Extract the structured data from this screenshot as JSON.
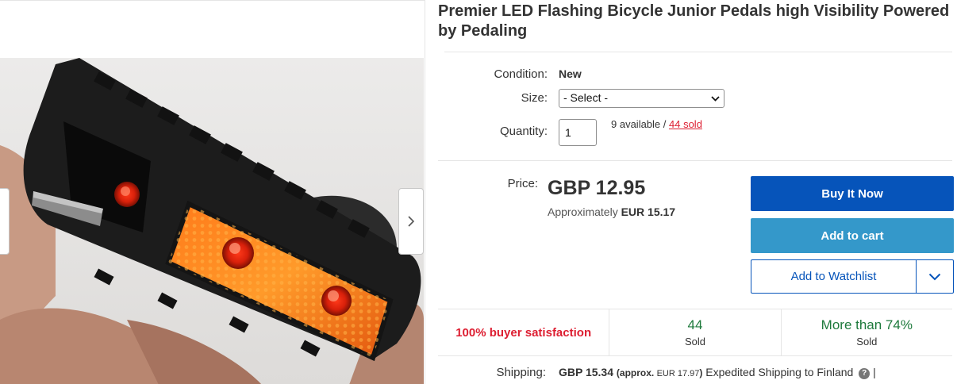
{
  "product": {
    "title": "Premier LED Flashing Bicycle Junior Pedals high Visibility Powered by Pedaling"
  },
  "gallery": {
    "prev_icon": "chevron-left-icon",
    "next_icon": "chevron-right-icon"
  },
  "details": {
    "condition_label": "Condition:",
    "condition_value": "New",
    "size_label": "Size:",
    "size_selected": "- Select -",
    "quantity_label": "Quantity:",
    "quantity_value": "1",
    "available_text": "9 available / ",
    "sold_link": "44 sold"
  },
  "pricing": {
    "price_label": "Price:",
    "price": "GBP 12.95",
    "approx_prefix": "Approximately ",
    "approx_value": "EUR 15.17"
  },
  "actions": {
    "buy_now": "Buy It Now",
    "add_to_cart": "Add to cart",
    "add_to_watchlist": "Add to Watchlist",
    "dropdown_icon": "chevron-down-icon"
  },
  "stats": {
    "satisfaction": "100% buyer satisfaction",
    "sold_count": "44",
    "sold_label": "Sold",
    "sold_percent": "More than 74%",
    "sold_percent_label": "Sold"
  },
  "shipping": {
    "label": "Shipping:",
    "cost": "GBP 15.34",
    "approx_open": "(approx. ",
    "approx_value": "EUR 17.97",
    "approx_close": ")",
    "service": " Expedited Shipping to Finland",
    "help_icon": "?",
    "separator": " |"
  },
  "colors": {
    "buy_now": "#0654ba",
    "add_to_cart": "#3498ca",
    "satisfaction": "#dd1e31",
    "stat_green": "#1e7a3c",
    "sold_link": "#dd1e31"
  }
}
